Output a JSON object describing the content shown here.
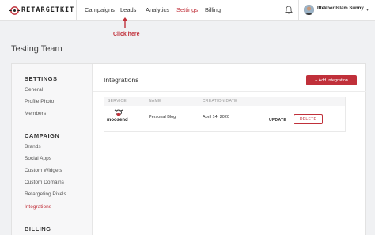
{
  "brand": {
    "logo_text": "RETARGETKIT",
    "accent": "#c0303a"
  },
  "nav": {
    "items": [
      "Campaigns",
      "Leads",
      "Analytics",
      "Settings",
      "Billing"
    ],
    "active": "Settings"
  },
  "user": {
    "name": "Iftekher Islam Sunny"
  },
  "annotation": {
    "text": "Click here"
  },
  "page": {
    "title": "Testing Team"
  },
  "sidebar": {
    "sections": [
      {
        "heading": "SETTINGS",
        "items": [
          "General",
          "Profile Photo",
          "Members"
        ]
      },
      {
        "heading": "CAMPAIGN",
        "items": [
          "Brands",
          "Social Apps",
          "Custom Widgets",
          "Custom Domains",
          "Retargeting Pixels",
          "Integrations"
        ]
      },
      {
        "heading": "BILLING",
        "items": []
      }
    ],
    "active_item": "Integrations"
  },
  "main": {
    "title": "Integrations",
    "add_button": "+ Add Integration",
    "table": {
      "headers": [
        "SERVICE",
        "NAME",
        "CREATION DATE"
      ],
      "rows": [
        {
          "service": "moosend",
          "name": "Personal Blog",
          "date": "April 14, 2020",
          "update": "UPDATE",
          "delete": "DELETE"
        }
      ]
    }
  }
}
